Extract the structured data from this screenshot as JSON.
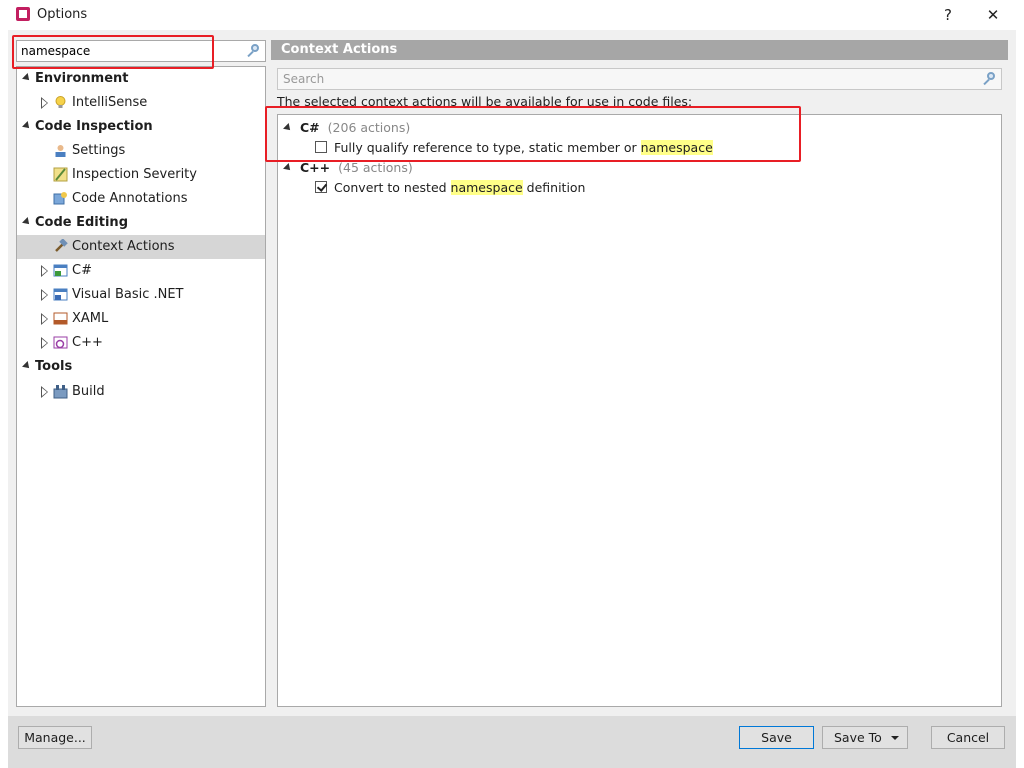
{
  "window": {
    "title": "Options",
    "help_label": "?",
    "close_label": "✕"
  },
  "left": {
    "search_value": "namespace",
    "tree": [
      {
        "type": "category",
        "label": "Environment"
      },
      {
        "type": "item",
        "label": "IntelliSense",
        "icon": "lightbulb-icon",
        "expandable": true
      },
      {
        "type": "category",
        "label": "Code Inspection"
      },
      {
        "type": "item",
        "label": "Settings",
        "icon": "settings-icon",
        "expandable": false
      },
      {
        "type": "item",
        "label": "Inspection Severity",
        "icon": "severity-icon",
        "expandable": false
      },
      {
        "type": "item",
        "label": "Code Annotations",
        "icon": "annotations-icon",
        "expandable": false
      },
      {
        "type": "category",
        "label": "Code Editing"
      },
      {
        "type": "item",
        "label": "Context Actions",
        "icon": "hammer-icon",
        "expandable": false,
        "selected": true
      },
      {
        "type": "item",
        "label": "C#",
        "icon": "csharp-icon",
        "expandable": true
      },
      {
        "type": "item",
        "label": "Visual Basic .NET",
        "icon": "vb-icon",
        "expandable": true
      },
      {
        "type": "item",
        "label": "XAML",
        "icon": "xaml-icon",
        "expandable": true
      },
      {
        "type": "item",
        "label": "C++",
        "icon": "cpp-icon",
        "expandable": true
      },
      {
        "type": "category",
        "label": "Tools"
      },
      {
        "type": "item",
        "label": "Build",
        "icon": "build-icon",
        "expandable": true
      }
    ]
  },
  "right": {
    "header": "Context Actions",
    "search_placeholder": "Search",
    "description": "The selected context actions will be available for use in code files:",
    "groups": [
      {
        "name": "C#",
        "count": "(206 actions)",
        "actions": [
          {
            "before": "Fully qualify reference to type, static member or ",
            "highlight": "namespace",
            "after": "",
            "checked": false
          }
        ]
      },
      {
        "name": "C++",
        "count": "(45 actions)",
        "actions": [
          {
            "before": "Convert to nested ",
            "highlight": "namespace",
            "after": " definition",
            "checked": true
          }
        ]
      }
    ]
  },
  "buttons": {
    "manage": "Manage...",
    "save": "Save",
    "save_to": "Save To",
    "cancel": "Cancel"
  },
  "colors": {
    "header_bg": "#a6a6a6",
    "highlight": "#ffff88",
    "annotation_red": "#e81e25",
    "primary_border": "#0078d7"
  }
}
